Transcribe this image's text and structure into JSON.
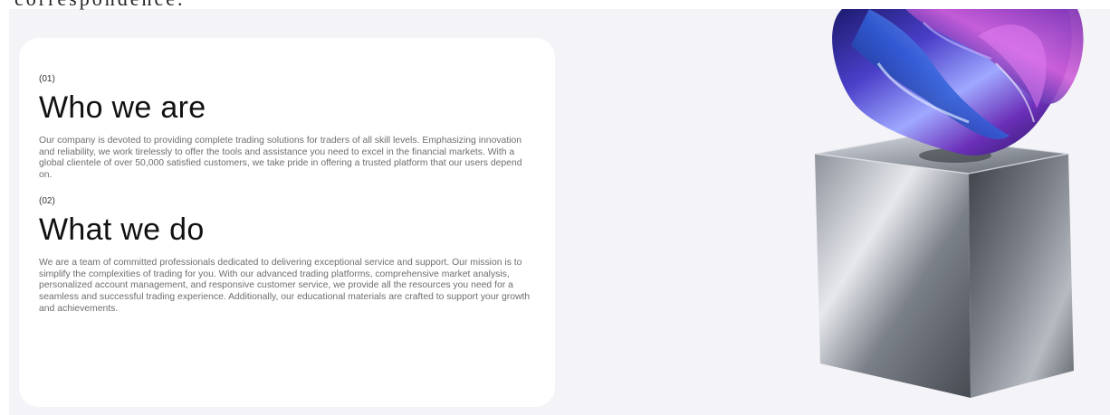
{
  "header_fragment": "correspondence.",
  "sections": [
    {
      "index": "(01)",
      "title": "Who we are",
      "body": "Our company is devoted to providing complete trading solutions for traders of all skill levels. Emphasizing innovation and reliability, we work tirelessly to offer the tools and assistance you need to excel in the financial markets. With a global clientele of over 50,000 satisfied customers, we take pride in offering a trusted platform that our users depend on."
    },
    {
      "index": "(02)",
      "title": "What we do",
      "body": "We are a team of committed professionals dedicated to delivering exceptional service and support. Our mission is to simplify the complexities of trading for you. With our advanced trading platforms, comprehensive market analysis, personalized account management, and responsive customer service, we provide all the resources you need for a seamless and successful trading experience. Additionally, our educational materials are crafted to support your growth and achievements."
    }
  ],
  "colors": {
    "background": "#f4f3f7",
    "card": "#ffffff",
    "title": "#111111",
    "body_text": "#6e6e6e"
  }
}
